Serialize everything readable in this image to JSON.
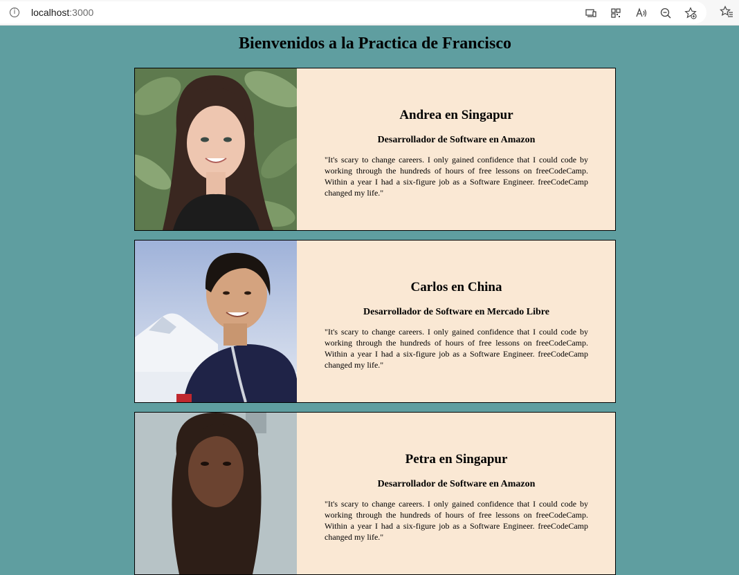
{
  "browser": {
    "url_host": "localhost",
    "url_port": ":3000"
  },
  "page": {
    "title": "Bienvenidos a la Practica de Francisco"
  },
  "testimonials": [
    {
      "name": "Andrea en Singapur",
      "role": "Desarrollador de Software en Amazon",
      "quote": "\"It's scary to change careers. I only gained confidence that I could code by working through the hundreds of hours of free lessons on freeCodeCamp. Within a year I had a six-figure job as a Software Engineer. freeCodeCamp changed my life.\""
    },
    {
      "name": "Carlos en China",
      "role": "Desarrollador de Software en Mercado Libre",
      "quote": "\"It's scary to change careers. I only gained confidence that I could code by working through the hundreds of hours of free lessons on freeCodeCamp. Within a year I had a six-figure job as a Software Engineer. freeCodeCamp changed my life.\""
    },
    {
      "name": "Petra en Singapur",
      "role": "Desarrollador de Software en Amazon",
      "quote": "\"It's scary to change careers. I only gained confidence that I could code by working through the hundreds of hours of free lessons on freeCodeCamp. Within a year I had a six-figure job as a Software Engineer. freeCodeCamp changed my life.\""
    }
  ]
}
